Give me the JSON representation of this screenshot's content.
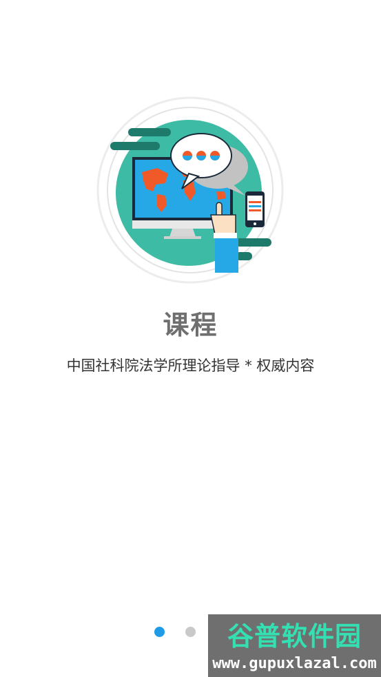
{
  "onboarding": {
    "illustration_icon": "monitor-world-map-chat-phone-illustration",
    "title": "课程",
    "subtitle": "中国社科院法学所理论指导 * 权威内容",
    "pager": {
      "pages": 2,
      "current": 1,
      "active_color": "#1e9be4",
      "inactive_color": "#c9c9c9"
    }
  },
  "watermark": {
    "title": "谷普软件园",
    "url": "www.gupuxlazal.com"
  },
  "colors": {
    "teal": "#3dbba5",
    "screen_blue": "#27a8e6",
    "map_orange": "#f05a28",
    "title_gray": "#6f6f6f"
  }
}
